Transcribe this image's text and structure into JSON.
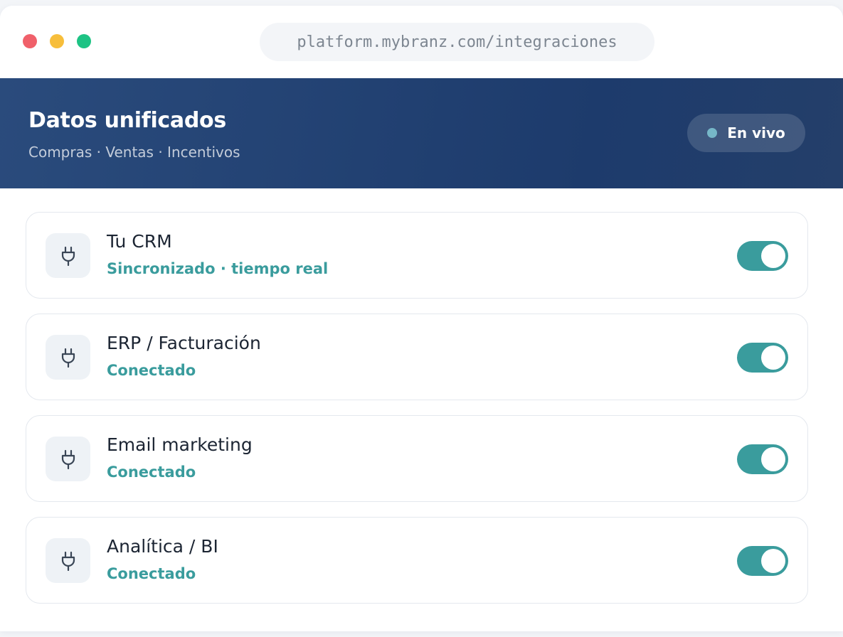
{
  "window": {
    "url": "platform.mybranz.com/integraciones"
  },
  "header": {
    "title": "Datos unificados",
    "subtitle": "Compras · Ventas · Incentivos",
    "live_label": "En vivo"
  },
  "integrations": [
    {
      "name": "Tu CRM",
      "status": "Sincronizado · tiempo real",
      "enabled": true,
      "icon": "plug-icon"
    },
    {
      "name": "ERP / Facturación",
      "status": "Conectado",
      "enabled": true,
      "icon": "plug-icon"
    },
    {
      "name": "Email marketing",
      "status": "Conectado",
      "enabled": true,
      "icon": "plug-icon"
    },
    {
      "name": "Analítica / BI",
      "status": "Conectado",
      "enabled": true,
      "icon": "plug-icon"
    }
  ],
  "colors": {
    "close": "#f0606a",
    "minimize": "#f7be3b",
    "maximize": "#1dc384",
    "accent": "#3a9c9d",
    "live_dot": "#76b7c8"
  }
}
